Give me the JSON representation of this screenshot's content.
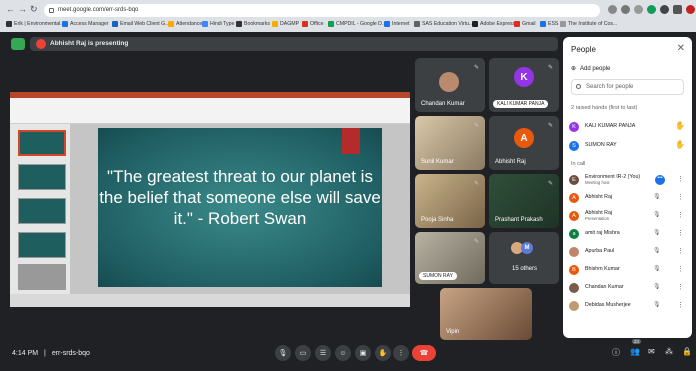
{
  "browser": {
    "url": "meet.google.com/err-srds-bqo",
    "bookmarks": [
      "Erik | Environmental...",
      "Access Manager",
      "Email Web Client G...",
      "Attendance",
      "Hindi Type",
      "Bookmarks",
      "DAGMP",
      "Office",
      "CMPDIL - Google D...",
      "Internet",
      "SAS Education Virtu...",
      "Adobe Express",
      "Gmail",
      "ESS",
      "The Institute of Cos..."
    ]
  },
  "meet": {
    "presenting_text": "Abhisht Raj is presenting",
    "slide_quote": "\"The greatest threat to our planet is the belief that someone else will save it.\" - Robert Swan",
    "time": "4:14 PM",
    "separator": "|",
    "meeting_code": "err-srds-bqo",
    "participant_badge": "24",
    "tiles": [
      {
        "name": "Chandan Kumar"
      },
      {
        "name": "KALI KUMAR PANJA",
        "initial": "K",
        "color": "#9334e6"
      },
      {
        "name": "Sunil Kumar"
      },
      {
        "name": "Abhisht Raj",
        "initial": "A",
        "color": "#e8590c"
      },
      {
        "name": "Pooja Sinha"
      },
      {
        "name": "Prashant Prakash"
      },
      {
        "name": "SUMON RAY"
      },
      {
        "name": "15 others",
        "initial": "M",
        "color": "#5b7bd5"
      },
      {
        "name": "Vipin"
      }
    ]
  },
  "people": {
    "title": "People",
    "add_people": "Add people",
    "search_placeholder": "Search for people",
    "raised_label": "2 raised hands (first to last)",
    "in_call_label": "In call",
    "raised": [
      {
        "name": "KALI KUMAR PANJA",
        "initial": "K",
        "color": "#9334e6"
      },
      {
        "name": "SUMON RAY",
        "initial": "S",
        "color": "#1a73e8"
      }
    ],
    "in_call": [
      {
        "name": "Environment IR-2 (You)",
        "sub": "Meeting host",
        "initial": "E",
        "color": "#6d4c41"
      },
      {
        "name": "Abhisht Raj",
        "sub": "",
        "initial": "A",
        "color": "#e8590c"
      },
      {
        "name": "Abhisht Raj",
        "sub": "Presentation",
        "initial": "A",
        "color": "#e8590c"
      },
      {
        "name": "amit raj Mishra",
        "sub": "",
        "initial": "a",
        "color": "#0b8043"
      },
      {
        "name": "Apurba Paul",
        "sub": "",
        "initial": "",
        "color": "#c0846b"
      },
      {
        "name": "Bhishm Kumar",
        "sub": "",
        "initial": "B",
        "color": "#e8590c"
      },
      {
        "name": "Chandan Kumar",
        "sub": "",
        "initial": "",
        "color": "#7a5c4a"
      },
      {
        "name": "Debidas Musherjee",
        "sub": "",
        "initial": "",
        "color": "#c09a70"
      }
    ]
  }
}
